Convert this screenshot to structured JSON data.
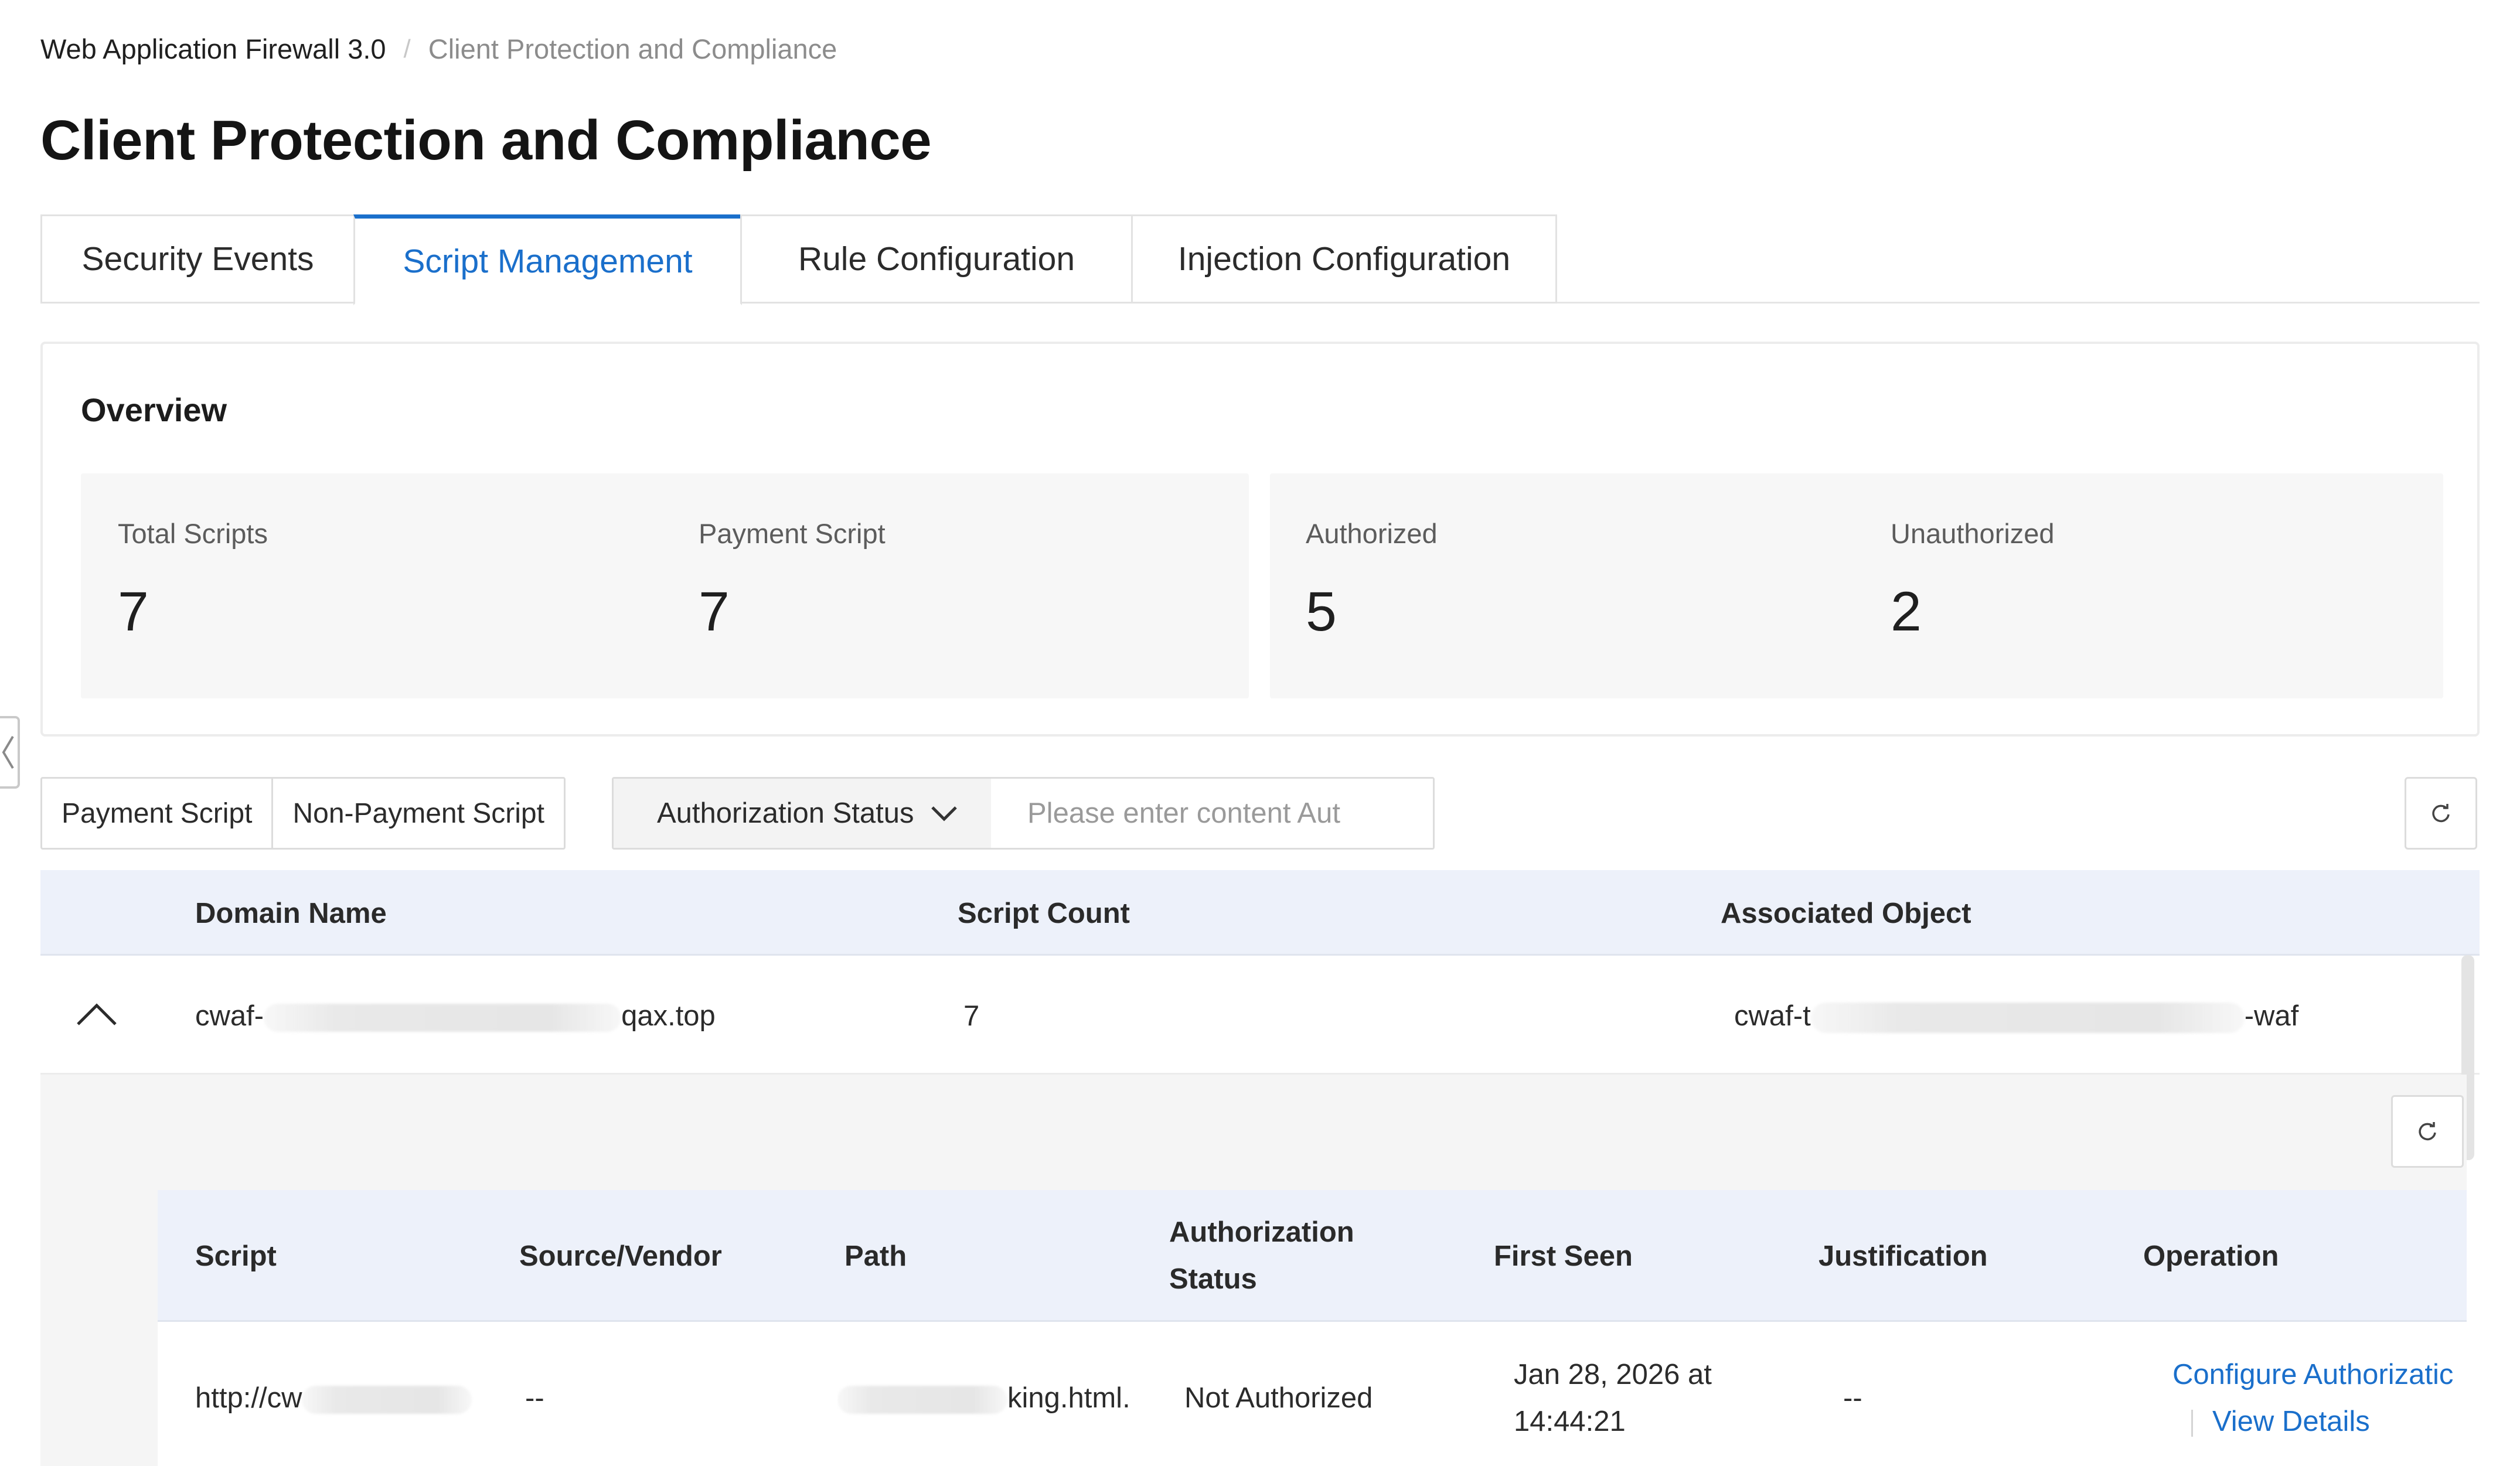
{
  "breadcrumb": {
    "root": "Web Application Firewall 3.0",
    "separator": "/",
    "current": "Client Protection and Compliance"
  },
  "page_title": "Client Protection and Compliance",
  "tabs": [
    {
      "label": "Security Events",
      "active": false
    },
    {
      "label": "Script Management",
      "active": true
    },
    {
      "label": "Rule Configuration",
      "active": false
    },
    {
      "label": "Injection Configuration",
      "active": false
    }
  ],
  "overview": {
    "title": "Overview",
    "stats": [
      {
        "label": "Total Scripts",
        "value": "7"
      },
      {
        "label": "Payment Script",
        "value": "7"
      },
      {
        "label": "Authorized",
        "value": "5"
      },
      {
        "label": "Unauthorized",
        "value": "2"
      }
    ]
  },
  "filters": {
    "segments": [
      "Payment Script",
      "Non-Payment Script"
    ],
    "select_label": "Authorization Status",
    "search_placeholder": "Please enter content Aut"
  },
  "table": {
    "columns": [
      "Domain Name",
      "Script Count",
      "Associated Object"
    ],
    "rows": [
      {
        "domain_prefix": "cwaf-",
        "domain_suffix": "qax.top",
        "script_count": "7",
        "object_prefix": "cwaf-t",
        "object_suffix": "-waf"
      }
    ]
  },
  "subtable": {
    "columns": {
      "script": "Script",
      "source": "Source/Vendor",
      "path": "Path",
      "auth_line1": "Authorization",
      "auth_line2": "Status",
      "first_seen": "First Seen",
      "justification": "Justification",
      "operation": "Operation"
    },
    "rows": [
      {
        "script_prefix": "http://cw",
        "source": "--",
        "path_suffix": "king.html.",
        "auth_status": "Not Authorized",
        "first_seen_line1": "Jan 28, 2026 at",
        "first_seen_line2": "14:44:21",
        "justification": "--",
        "op_configure": "Configure Authorizatic",
        "op_view": "View Details"
      }
    ]
  },
  "colors": {
    "accent": "#1a6fcb",
    "header_bg": "#edf1fa",
    "panel_bg": "#f7f7f7"
  }
}
